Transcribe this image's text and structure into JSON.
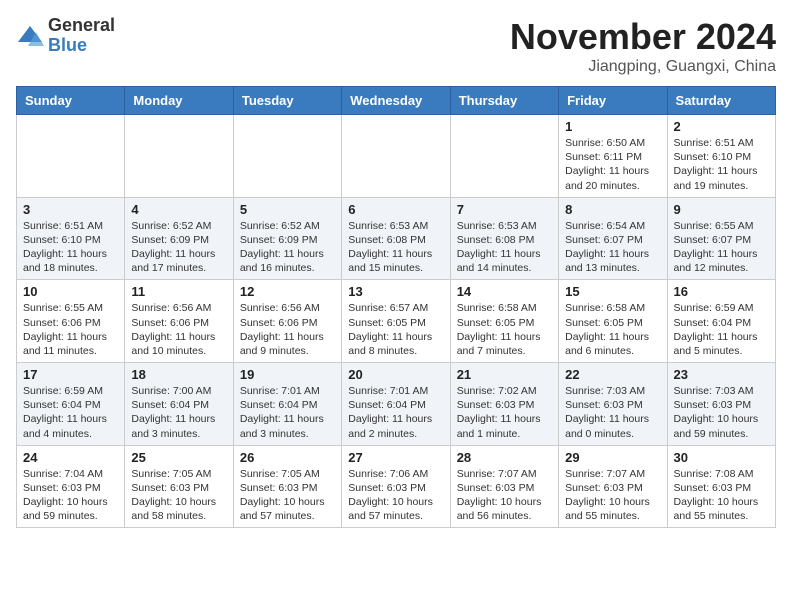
{
  "header": {
    "logo": {
      "general": "General",
      "blue": "Blue"
    },
    "title": "November 2024",
    "location": "Jiangping, Guangxi, China"
  },
  "weekdays": [
    "Sunday",
    "Monday",
    "Tuesday",
    "Wednesday",
    "Thursday",
    "Friday",
    "Saturday"
  ],
  "weeks": [
    [
      {
        "day": "",
        "detail": ""
      },
      {
        "day": "",
        "detail": ""
      },
      {
        "day": "",
        "detail": ""
      },
      {
        "day": "",
        "detail": ""
      },
      {
        "day": "",
        "detail": ""
      },
      {
        "day": "1",
        "detail": "Sunrise: 6:50 AM\nSunset: 6:11 PM\nDaylight: 11 hours\nand 20 minutes."
      },
      {
        "day": "2",
        "detail": "Sunrise: 6:51 AM\nSunset: 6:10 PM\nDaylight: 11 hours\nand 19 minutes."
      }
    ],
    [
      {
        "day": "3",
        "detail": "Sunrise: 6:51 AM\nSunset: 6:10 PM\nDaylight: 11 hours\nand 18 minutes."
      },
      {
        "day": "4",
        "detail": "Sunrise: 6:52 AM\nSunset: 6:09 PM\nDaylight: 11 hours\nand 17 minutes."
      },
      {
        "day": "5",
        "detail": "Sunrise: 6:52 AM\nSunset: 6:09 PM\nDaylight: 11 hours\nand 16 minutes."
      },
      {
        "day": "6",
        "detail": "Sunrise: 6:53 AM\nSunset: 6:08 PM\nDaylight: 11 hours\nand 15 minutes."
      },
      {
        "day": "7",
        "detail": "Sunrise: 6:53 AM\nSunset: 6:08 PM\nDaylight: 11 hours\nand 14 minutes."
      },
      {
        "day": "8",
        "detail": "Sunrise: 6:54 AM\nSunset: 6:07 PM\nDaylight: 11 hours\nand 13 minutes."
      },
      {
        "day": "9",
        "detail": "Sunrise: 6:55 AM\nSunset: 6:07 PM\nDaylight: 11 hours\nand 12 minutes."
      }
    ],
    [
      {
        "day": "10",
        "detail": "Sunrise: 6:55 AM\nSunset: 6:06 PM\nDaylight: 11 hours\nand 11 minutes."
      },
      {
        "day": "11",
        "detail": "Sunrise: 6:56 AM\nSunset: 6:06 PM\nDaylight: 11 hours\nand 10 minutes."
      },
      {
        "day": "12",
        "detail": "Sunrise: 6:56 AM\nSunset: 6:06 PM\nDaylight: 11 hours\nand 9 minutes."
      },
      {
        "day": "13",
        "detail": "Sunrise: 6:57 AM\nSunset: 6:05 PM\nDaylight: 11 hours\nand 8 minutes."
      },
      {
        "day": "14",
        "detail": "Sunrise: 6:58 AM\nSunset: 6:05 PM\nDaylight: 11 hours\nand 7 minutes."
      },
      {
        "day": "15",
        "detail": "Sunrise: 6:58 AM\nSunset: 6:05 PM\nDaylight: 11 hours\nand 6 minutes."
      },
      {
        "day": "16",
        "detail": "Sunrise: 6:59 AM\nSunset: 6:04 PM\nDaylight: 11 hours\nand 5 minutes."
      }
    ],
    [
      {
        "day": "17",
        "detail": "Sunrise: 6:59 AM\nSunset: 6:04 PM\nDaylight: 11 hours\nand 4 minutes."
      },
      {
        "day": "18",
        "detail": "Sunrise: 7:00 AM\nSunset: 6:04 PM\nDaylight: 11 hours\nand 3 minutes."
      },
      {
        "day": "19",
        "detail": "Sunrise: 7:01 AM\nSunset: 6:04 PM\nDaylight: 11 hours\nand 3 minutes."
      },
      {
        "day": "20",
        "detail": "Sunrise: 7:01 AM\nSunset: 6:04 PM\nDaylight: 11 hours\nand 2 minutes."
      },
      {
        "day": "21",
        "detail": "Sunrise: 7:02 AM\nSunset: 6:03 PM\nDaylight: 11 hours\nand 1 minute."
      },
      {
        "day": "22",
        "detail": "Sunrise: 7:03 AM\nSunset: 6:03 PM\nDaylight: 11 hours\nand 0 minutes."
      },
      {
        "day": "23",
        "detail": "Sunrise: 7:03 AM\nSunset: 6:03 PM\nDaylight: 10 hours\nand 59 minutes."
      }
    ],
    [
      {
        "day": "24",
        "detail": "Sunrise: 7:04 AM\nSunset: 6:03 PM\nDaylight: 10 hours\nand 59 minutes."
      },
      {
        "day": "25",
        "detail": "Sunrise: 7:05 AM\nSunset: 6:03 PM\nDaylight: 10 hours\nand 58 minutes."
      },
      {
        "day": "26",
        "detail": "Sunrise: 7:05 AM\nSunset: 6:03 PM\nDaylight: 10 hours\nand 57 minutes."
      },
      {
        "day": "27",
        "detail": "Sunrise: 7:06 AM\nSunset: 6:03 PM\nDaylight: 10 hours\nand 57 minutes."
      },
      {
        "day": "28",
        "detail": "Sunrise: 7:07 AM\nSunset: 6:03 PM\nDaylight: 10 hours\nand 56 minutes."
      },
      {
        "day": "29",
        "detail": "Sunrise: 7:07 AM\nSunset: 6:03 PM\nDaylight: 10 hours\nand 55 minutes."
      },
      {
        "day": "30",
        "detail": "Sunrise: 7:08 AM\nSunset: 6:03 PM\nDaylight: 10 hours\nand 55 minutes."
      }
    ]
  ]
}
